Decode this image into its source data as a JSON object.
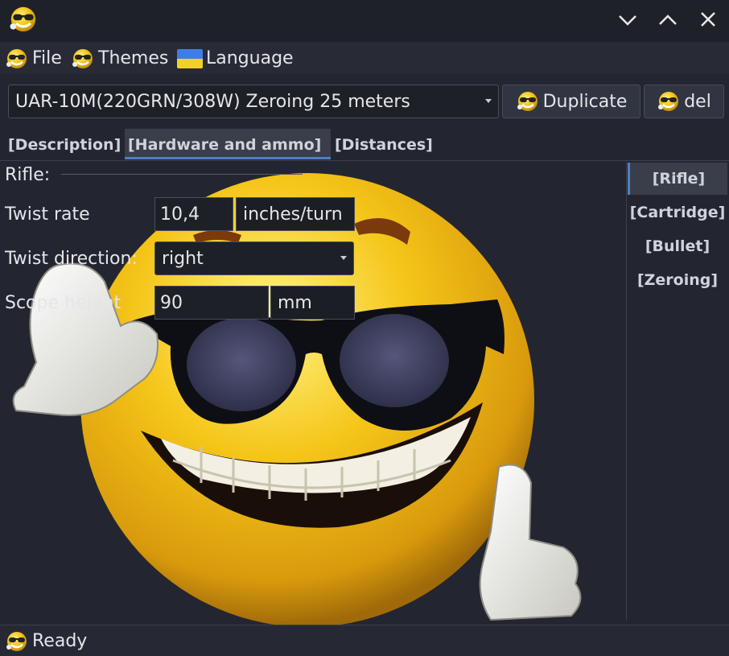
{
  "menu": {
    "file": "File",
    "themes": "Themes",
    "language": "Language"
  },
  "toolbar": {
    "profile_selected": "UAR-10M(220GRN/308W) Zeroing 25 meters",
    "duplicate_label": "Duplicate",
    "delete_label": "del"
  },
  "tabs": [
    {
      "label": "[Description]"
    },
    {
      "label": "[Hardware and ammo]"
    },
    {
      "label": "[Distances]"
    }
  ],
  "rifle": {
    "section_label": "Rifle:",
    "twist_rate_label": "Twist rate",
    "twist_rate_value": "10,4",
    "twist_rate_unit": "inches/turn",
    "twist_direction_label": "Twist direction:",
    "twist_direction_value": "right",
    "scope_height_label": "Scope height",
    "scope_height_value": "90",
    "scope_height_unit": "mm"
  },
  "side_tabs": [
    {
      "label": "[Rifle]"
    },
    {
      "label": "[Cartridge]"
    },
    {
      "label": "[Bullet]"
    },
    {
      "label": "[Zeroing]"
    }
  ],
  "status": {
    "text": "Ready"
  },
  "colors": {
    "background": "#232630",
    "accent": "#4f7fc6",
    "emoji_yellow": "#f2c21b",
    "flag_blue": "#3d7de6",
    "flag_yellow": "#f3cf2e"
  },
  "icons": {
    "app": "cool-smiley-icon",
    "minimize": "chevron-down-icon",
    "maximize": "chevron-up-icon",
    "close": "close-icon",
    "language": "ukraine-flag-icon"
  }
}
